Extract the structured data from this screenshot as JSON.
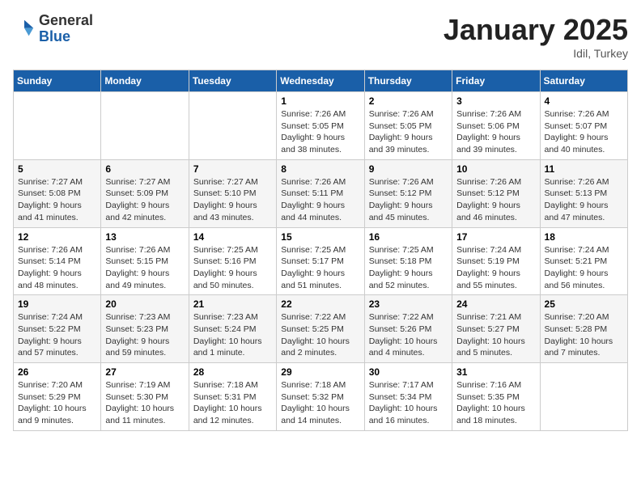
{
  "logo": {
    "general": "General",
    "blue": "Blue"
  },
  "header": {
    "title": "January 2025",
    "subtitle": "Idil, Turkey"
  },
  "weekdays": [
    "Sunday",
    "Monday",
    "Tuesday",
    "Wednesday",
    "Thursday",
    "Friday",
    "Saturday"
  ],
  "weeks": [
    [
      {
        "day": "",
        "content": ""
      },
      {
        "day": "",
        "content": ""
      },
      {
        "day": "",
        "content": ""
      },
      {
        "day": "1",
        "content": "Sunrise: 7:26 AM\nSunset: 5:05 PM\nDaylight: 9 hours\nand 38 minutes."
      },
      {
        "day": "2",
        "content": "Sunrise: 7:26 AM\nSunset: 5:05 PM\nDaylight: 9 hours\nand 39 minutes."
      },
      {
        "day": "3",
        "content": "Sunrise: 7:26 AM\nSunset: 5:06 PM\nDaylight: 9 hours\nand 39 minutes."
      },
      {
        "day": "4",
        "content": "Sunrise: 7:26 AM\nSunset: 5:07 PM\nDaylight: 9 hours\nand 40 minutes."
      }
    ],
    [
      {
        "day": "5",
        "content": "Sunrise: 7:27 AM\nSunset: 5:08 PM\nDaylight: 9 hours\nand 41 minutes."
      },
      {
        "day": "6",
        "content": "Sunrise: 7:27 AM\nSunset: 5:09 PM\nDaylight: 9 hours\nand 42 minutes."
      },
      {
        "day": "7",
        "content": "Sunrise: 7:27 AM\nSunset: 5:10 PM\nDaylight: 9 hours\nand 43 minutes."
      },
      {
        "day": "8",
        "content": "Sunrise: 7:26 AM\nSunset: 5:11 PM\nDaylight: 9 hours\nand 44 minutes."
      },
      {
        "day": "9",
        "content": "Sunrise: 7:26 AM\nSunset: 5:12 PM\nDaylight: 9 hours\nand 45 minutes."
      },
      {
        "day": "10",
        "content": "Sunrise: 7:26 AM\nSunset: 5:12 PM\nDaylight: 9 hours\nand 46 minutes."
      },
      {
        "day": "11",
        "content": "Sunrise: 7:26 AM\nSunset: 5:13 PM\nDaylight: 9 hours\nand 47 minutes."
      }
    ],
    [
      {
        "day": "12",
        "content": "Sunrise: 7:26 AM\nSunset: 5:14 PM\nDaylight: 9 hours\nand 48 minutes."
      },
      {
        "day": "13",
        "content": "Sunrise: 7:26 AM\nSunset: 5:15 PM\nDaylight: 9 hours\nand 49 minutes."
      },
      {
        "day": "14",
        "content": "Sunrise: 7:25 AM\nSunset: 5:16 PM\nDaylight: 9 hours\nand 50 minutes."
      },
      {
        "day": "15",
        "content": "Sunrise: 7:25 AM\nSunset: 5:17 PM\nDaylight: 9 hours\nand 51 minutes."
      },
      {
        "day": "16",
        "content": "Sunrise: 7:25 AM\nSunset: 5:18 PM\nDaylight: 9 hours\nand 52 minutes."
      },
      {
        "day": "17",
        "content": "Sunrise: 7:24 AM\nSunset: 5:19 PM\nDaylight: 9 hours\nand 55 minutes."
      },
      {
        "day": "18",
        "content": "Sunrise: 7:24 AM\nSunset: 5:21 PM\nDaylight: 9 hours\nand 56 minutes."
      }
    ],
    [
      {
        "day": "19",
        "content": "Sunrise: 7:24 AM\nSunset: 5:22 PM\nDaylight: 9 hours\nand 57 minutes."
      },
      {
        "day": "20",
        "content": "Sunrise: 7:23 AM\nSunset: 5:23 PM\nDaylight: 9 hours\nand 59 minutes."
      },
      {
        "day": "21",
        "content": "Sunrise: 7:23 AM\nSunset: 5:24 PM\nDaylight: 10 hours\nand 1 minute."
      },
      {
        "day": "22",
        "content": "Sunrise: 7:22 AM\nSunset: 5:25 PM\nDaylight: 10 hours\nand 2 minutes."
      },
      {
        "day": "23",
        "content": "Sunrise: 7:22 AM\nSunset: 5:26 PM\nDaylight: 10 hours\nand 4 minutes."
      },
      {
        "day": "24",
        "content": "Sunrise: 7:21 AM\nSunset: 5:27 PM\nDaylight: 10 hours\nand 5 minutes."
      },
      {
        "day": "25",
        "content": "Sunrise: 7:20 AM\nSunset: 5:28 PM\nDaylight: 10 hours\nand 7 minutes."
      }
    ],
    [
      {
        "day": "26",
        "content": "Sunrise: 7:20 AM\nSunset: 5:29 PM\nDaylight: 10 hours\nand 9 minutes."
      },
      {
        "day": "27",
        "content": "Sunrise: 7:19 AM\nSunset: 5:30 PM\nDaylight: 10 hours\nand 11 minutes."
      },
      {
        "day": "28",
        "content": "Sunrise: 7:18 AM\nSunset: 5:31 PM\nDaylight: 10 hours\nand 12 minutes."
      },
      {
        "day": "29",
        "content": "Sunrise: 7:18 AM\nSunset: 5:32 PM\nDaylight: 10 hours\nand 14 minutes."
      },
      {
        "day": "30",
        "content": "Sunrise: 7:17 AM\nSunset: 5:34 PM\nDaylight: 10 hours\nand 16 minutes."
      },
      {
        "day": "31",
        "content": "Sunrise: 7:16 AM\nSunset: 5:35 PM\nDaylight: 10 hours\nand 18 minutes."
      },
      {
        "day": "",
        "content": ""
      }
    ]
  ]
}
